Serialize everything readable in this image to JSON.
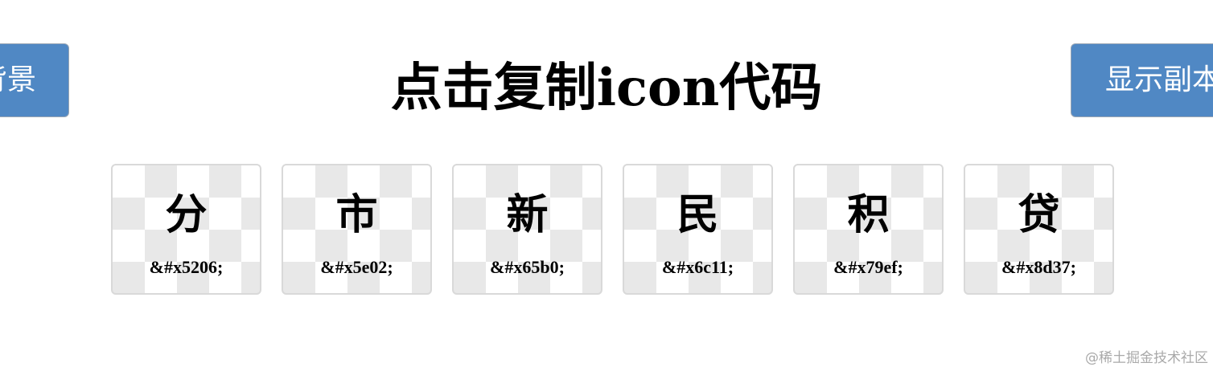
{
  "buttons": {
    "left_label": "背景",
    "right_label": "显示副本"
  },
  "title": "点击复制icon代码",
  "icons": [
    {
      "glyph": "分",
      "code": "&#x5206;"
    },
    {
      "glyph": "市",
      "code": "&#x5e02;"
    },
    {
      "glyph": "新",
      "code": "&#x65b0;"
    },
    {
      "glyph": "民",
      "code": "&#x6c11;"
    },
    {
      "glyph": "积",
      "code": "&#x79ef;"
    },
    {
      "glyph": "贷",
      "code": "&#x8d37;"
    }
  ],
  "watermark": "@稀土掘金技术社区",
  "colors": {
    "button_bg": "#5088c4",
    "button_text": "#ffffff",
    "card_border": "#d9d9d9",
    "checker": "#e8e8e8"
  }
}
